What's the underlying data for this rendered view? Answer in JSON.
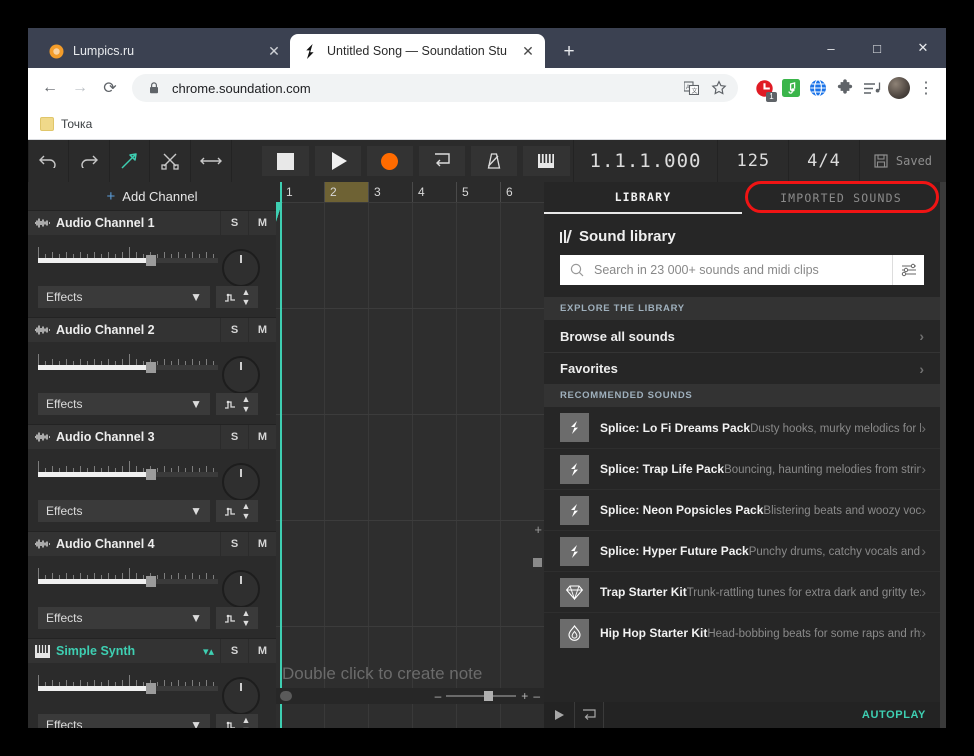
{
  "browser": {
    "tabs": [
      {
        "title": "Lumpics.ru",
        "favicon": "orange-circle-icon",
        "active": false
      },
      {
        "title": "Untitled Song — Soundation Stu",
        "favicon": "soundation-logo-icon",
        "active": true
      }
    ],
    "new_tab_label": "+",
    "window_controls": {
      "minimize": "–",
      "maximize": "□",
      "close": "✕"
    },
    "nav": {
      "back": "←",
      "forward": "→",
      "reload": "⟳"
    },
    "omnibox": {
      "url": "chrome.soundation.com",
      "lock": "lock-icon",
      "translate": "translate-icon",
      "bookmark": "star-icon"
    },
    "extensions": [
      {
        "name": "adblock-extension-icon",
        "badge": "1"
      },
      {
        "name": "music-extension-icon",
        "badge": ""
      },
      {
        "name": "globe-extension-icon",
        "badge": ""
      },
      {
        "name": "puzzle-extensions-icon",
        "badge": ""
      },
      {
        "name": "media-list-icon",
        "badge": ""
      }
    ],
    "profile": "avatar",
    "menu": "⋮",
    "bookmarks": [
      {
        "label": "Точка"
      }
    ]
  },
  "toolbar": {
    "undo": "undo-icon",
    "redo": "redo-icon",
    "pointer": "pointer-tool-icon",
    "cut": "scissors-tool-icon",
    "resize": "resize-tool-icon",
    "stop": "stop-button",
    "play": "play-button",
    "record": "record-button",
    "loop": "loop-button",
    "metronome": "metronome-button",
    "keyboard": "keyboard-button",
    "position": "1.1.1.000",
    "tempo": "125",
    "time_signature": "4/4",
    "save_label": "Saved"
  },
  "channels": {
    "add_label": "Add Channel",
    "add_plus": "+",
    "solo_label": "S",
    "mute_label": "M",
    "effects_label": "Effects",
    "items": [
      {
        "name": "Audio Channel 1",
        "icon": "waveform-icon",
        "teal": false
      },
      {
        "name": "Audio Channel 2",
        "icon": "waveform-icon",
        "teal": false
      },
      {
        "name": "Audio Channel 3",
        "icon": "waveform-icon",
        "teal": false
      },
      {
        "name": "Audio Channel 4",
        "icon": "waveform-icon",
        "teal": false
      },
      {
        "name": "Simple Synth",
        "icon": "piano-keys-icon",
        "teal": true
      }
    ]
  },
  "arrangement": {
    "bars": [
      "1",
      "2",
      "3",
      "4",
      "5",
      "6"
    ],
    "loop_bar": "2",
    "hint": "Double click to create note",
    "zoom_minus": "–",
    "zoom_plus": "+",
    "zoom_minus2": "–",
    "vzoom_plus": "+"
  },
  "library": {
    "tabs": [
      {
        "label": "LIBRARY",
        "active": true
      },
      {
        "label": "IMPORTED SOUNDS",
        "active": false,
        "highlighted": true
      }
    ],
    "title": "Sound library",
    "title_icon": "library-bars-icon",
    "search": {
      "placeholder": "Search in 23 000+ sounds and midi clips",
      "icon": "search-icon",
      "filter_icon": "filter-sliders-icon"
    },
    "explore_header": "EXPLORE THE LIBRARY",
    "nav": [
      {
        "label": "Browse all sounds"
      },
      {
        "label": "Favorites"
      }
    ],
    "recommended_header": "RECOMMENDED SOUNDS",
    "packs": [
      {
        "title": "Splice: Lo Fi Dreams Pack",
        "subtitle": "Dusty hooks, murky melodics for bedroom beat aesthetics",
        "icon": "splice-icon"
      },
      {
        "title": "Splice: Trap Life Pack",
        "subtitle": "Bouncing, haunting melodies from strings and drums",
        "icon": "splice-icon"
      },
      {
        "title": "Splice: Neon Popsicles Pack",
        "subtitle": "Blistering beats and woozy vocals for pure pop vibes",
        "icon": "splice-icon"
      },
      {
        "title": "Splice: Hyper Future Pack",
        "subtitle": "Punchy drums, catchy vocals and other Future Pop essentials",
        "icon": "splice-icon"
      },
      {
        "title": "Trap Starter Kit",
        "subtitle": "Trunk-rattling tunes for extra dark and gritty textures",
        "icon": "diamond-icon"
      },
      {
        "title": "Hip Hop Starter Kit",
        "subtitle": "Head-bobbing beats for some raps and rhymes",
        "icon": "flame-icon"
      }
    ],
    "footer": {
      "play": "play-icon",
      "loop": "loop-icon",
      "autoplay": "AUTOPLAY"
    }
  },
  "rail": {
    "items": [
      {
        "name": "library-rail-icon",
        "active": true
      },
      {
        "name": "folder-rail-icon",
        "active": false
      },
      {
        "name": "export-arrow-rail-icon",
        "active": false
      },
      {
        "name": "help-rail-icon",
        "active": false,
        "glyph": "?"
      },
      {
        "name": "settings-sliders-rail-icon",
        "active": false
      }
    ],
    "bottom": [
      {
        "name": "close-rail-icon",
        "glyph": "✕"
      },
      {
        "name": "expand-rail-icon",
        "glyph": "⤡"
      }
    ]
  },
  "colors": {
    "accent_teal": "#3ecfb2",
    "record_orange": "#ff6b00",
    "highlight_red": "#f01414",
    "loop_olive": "#6e6234"
  }
}
